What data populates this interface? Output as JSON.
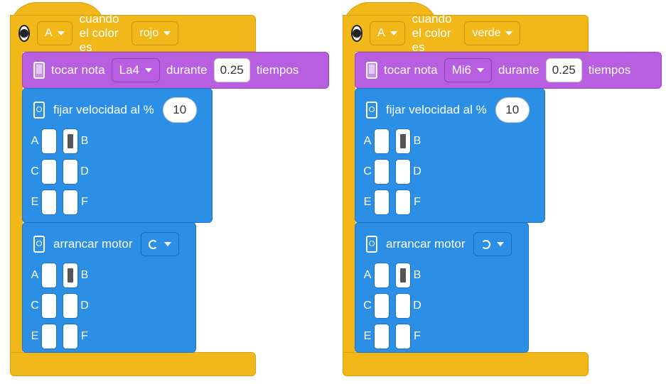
{
  "stacks": [
    {
      "hat": {
        "port": "A",
        "text": "cuando el color es",
        "color": "rojo"
      },
      "sound": {
        "label": "tocar nota",
        "note": "La4",
        "during": "durante",
        "duration": "0.25",
        "unit": "tiempos"
      },
      "speed": {
        "label": "fijar velocidad al %",
        "value": "10",
        "ports": [
          "A",
          "B",
          "C",
          "D",
          "E",
          "F"
        ],
        "selected": [
          "B"
        ]
      },
      "motor": {
        "label": "arrancar motor",
        "direction": "clockwise",
        "ports": [
          "A",
          "B",
          "C",
          "D",
          "E",
          "F"
        ],
        "selected": [
          "B"
        ]
      }
    },
    {
      "hat": {
        "port": "A",
        "text": "cuando el color es",
        "color": "verde"
      },
      "sound": {
        "label": "tocar nota",
        "note": "Mi6",
        "during": "durante",
        "duration": "0.25",
        "unit": "tiempos"
      },
      "speed": {
        "label": "fijar velocidad al %",
        "value": "10",
        "ports": [
          "A",
          "B",
          "C",
          "D",
          "E",
          "F"
        ],
        "selected": [
          "B"
        ]
      },
      "motor": {
        "label": "arrancar motor",
        "direction": "counterclockwise",
        "ports": [
          "A",
          "B",
          "C",
          "D",
          "E",
          "F"
        ],
        "selected": [
          "B"
        ]
      }
    }
  ],
  "colors": {
    "events": "#f2b718",
    "sound": "#b85ee0",
    "motor": "#2c8fe6"
  }
}
